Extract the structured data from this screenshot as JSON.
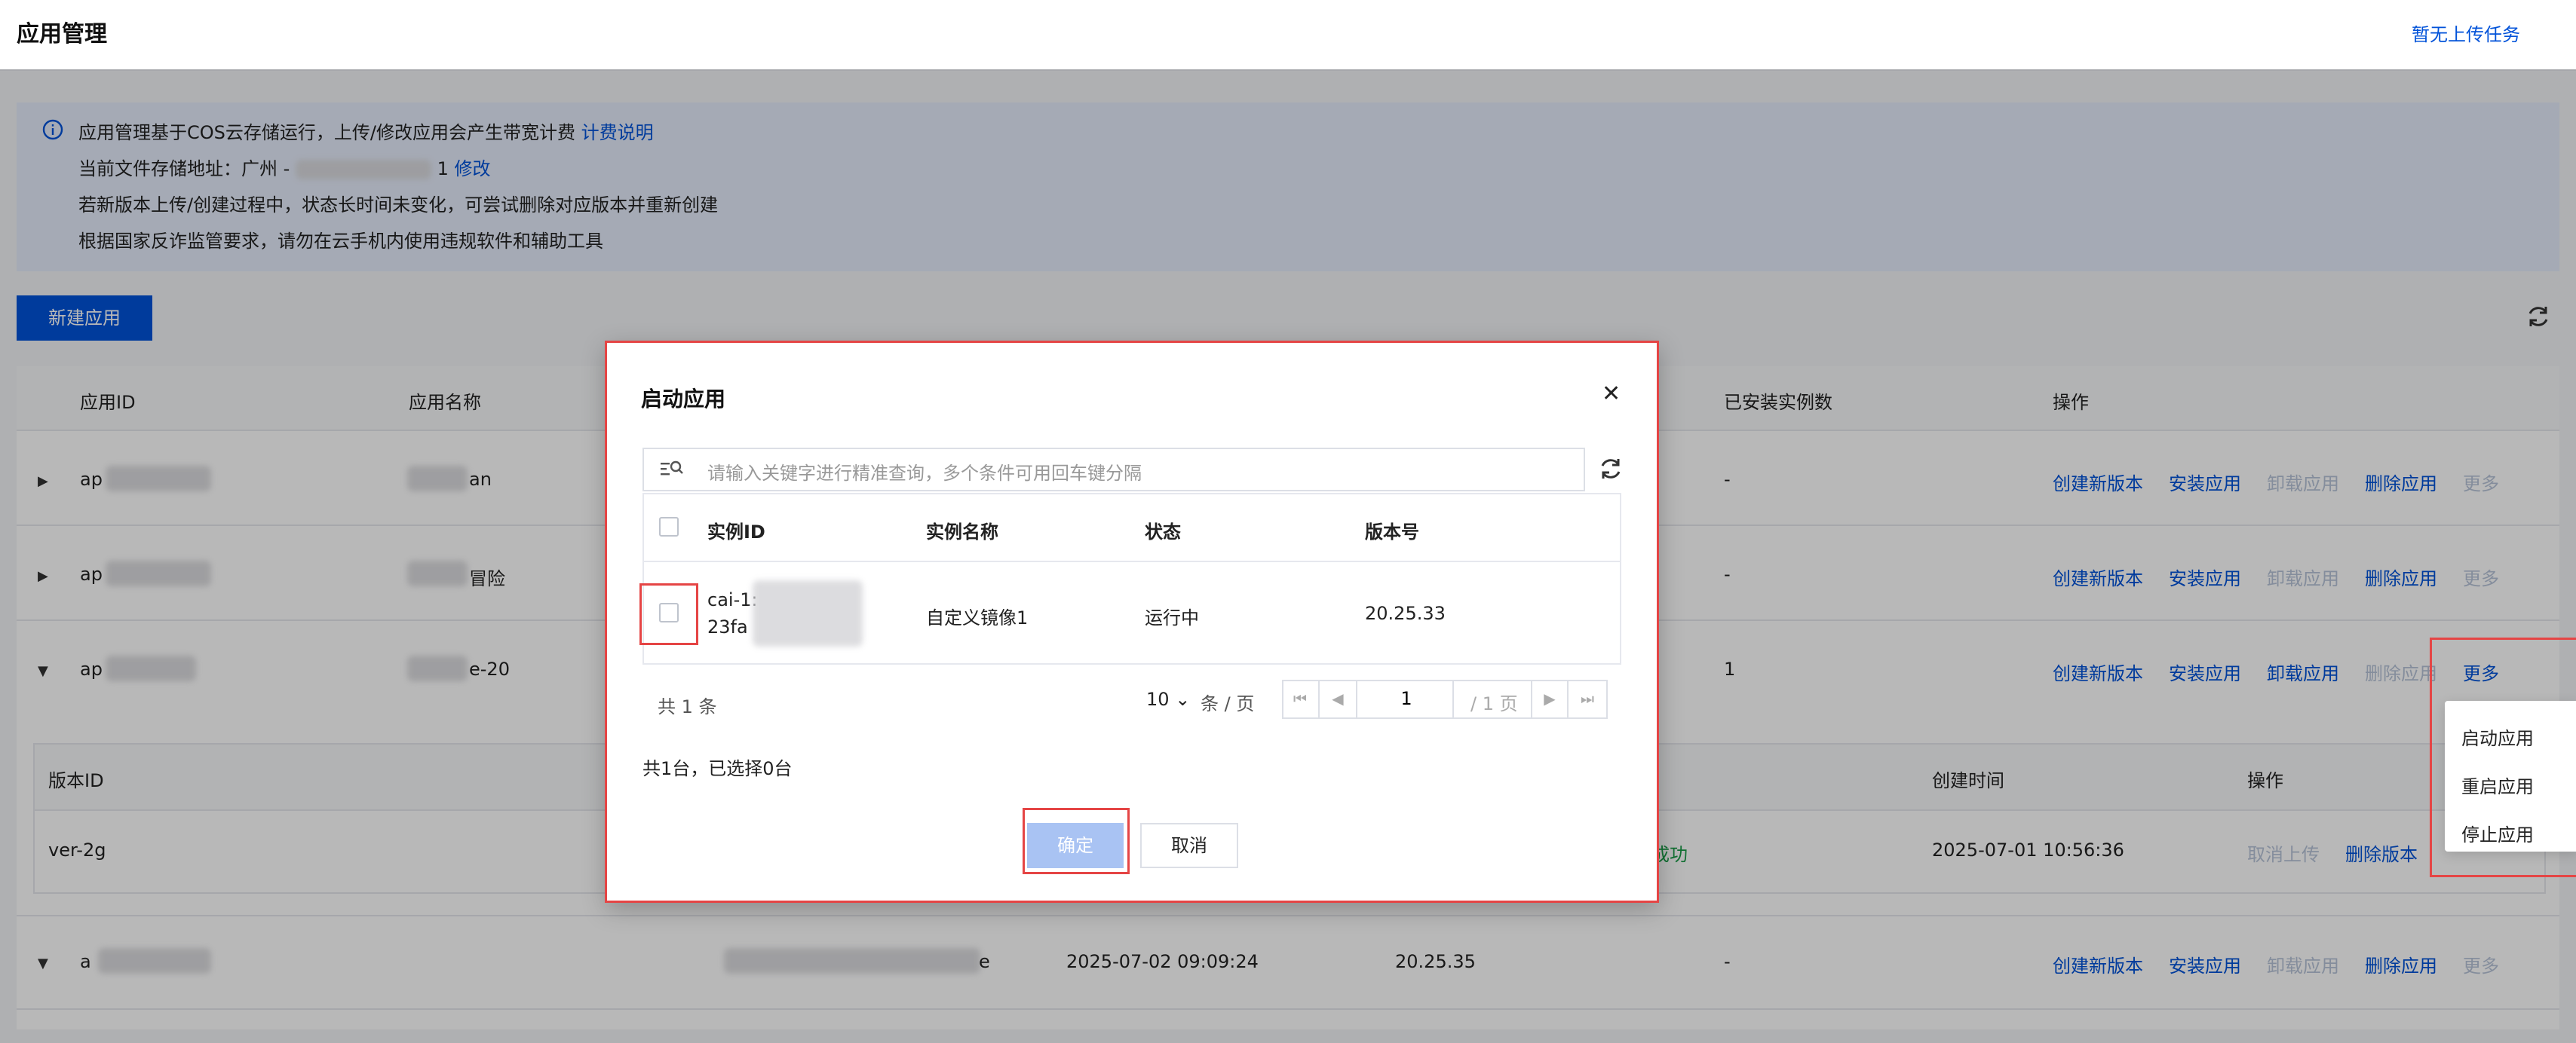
{
  "page": {
    "title": "应用管理",
    "upload_tasks": "暂无上传任务"
  },
  "notice": {
    "line1_text": "应用管理基于COS云存储运行，上传/修改应用会产生带宽计费",
    "line1_link": "计费说明",
    "line2_text": "当前文件存储地址：广州 - ",
    "line2_suffix": "1",
    "line2_link": "修改",
    "line3_text": "若新版本上传/创建过程中，状态长时间未变化，可尝试删除对应版本并重新创建",
    "line4_text": "根据国家反诈监管要求，请勿在云手机内使用违规软件和辅助工具"
  },
  "toolbar": {
    "new_app": "新建应用"
  },
  "table": {
    "headers": {
      "app_id": "应用ID",
      "app_name": "应用名称",
      "installed": "已安装实例数",
      "ops": "操作"
    },
    "rows": [
      {
        "id_prefix": "ap",
        "name_suffix": "an",
        "installed": "-",
        "ops": [
          "创建新版本",
          "安装应用",
          "卸载应用",
          "删除应用",
          "更多"
        ]
      },
      {
        "id_prefix": "ap",
        "name_suffix": "冒险",
        "installed": "-",
        "ops": [
          "创建新版本",
          "安装应用",
          "卸载应用",
          "删除应用",
          "更多"
        ]
      },
      {
        "id_prefix": "ap",
        "name_suffix": "e-20",
        "installed": "1",
        "ops": [
          "创建新版本",
          "安装应用",
          "卸载应用",
          "删除应用",
          "更多"
        ]
      },
      {
        "id_prefix": "a",
        "name_suffix": "e",
        "time": "2025-07-02 09:09:24",
        "version": "20.25.35",
        "installed": "-",
        "ops": [
          "创建新版本",
          "安装应用",
          "卸载应用",
          "删除应用",
          "更多"
        ]
      }
    ],
    "sub": {
      "headers": {
        "version_id": "版本ID",
        "created": "创建时间",
        "ops": "操作"
      },
      "row": {
        "version_id": "ver-2g",
        "status_tail": "成功",
        "created": "2025-07-01 10:56:36",
        "ops": [
          "取消上传",
          "删除版本"
        ]
      }
    }
  },
  "dropdown": {
    "items": [
      "启动应用",
      "重启应用",
      "停止应用"
    ]
  },
  "modal": {
    "title": "启动应用",
    "search_placeholder": "请输入关键字进行精准查询，多个条件可用回车键分隔",
    "headers": {
      "instance_id": "实例ID",
      "instance_name": "实例名称",
      "status": "状态",
      "version": "版本号"
    },
    "row": {
      "id_line1": "cai-1:",
      "id_line2": "23fa",
      "name": "自定义镜像1",
      "status": "运行中",
      "version": "20.25.33"
    },
    "total": "共 1 条",
    "page_size": "10",
    "page_size_unit": "条 / 页",
    "page_num": "1",
    "page_of": "/ 1 页",
    "summary": "共1台，已选择0台",
    "ok": "确定",
    "cancel": "取消"
  }
}
